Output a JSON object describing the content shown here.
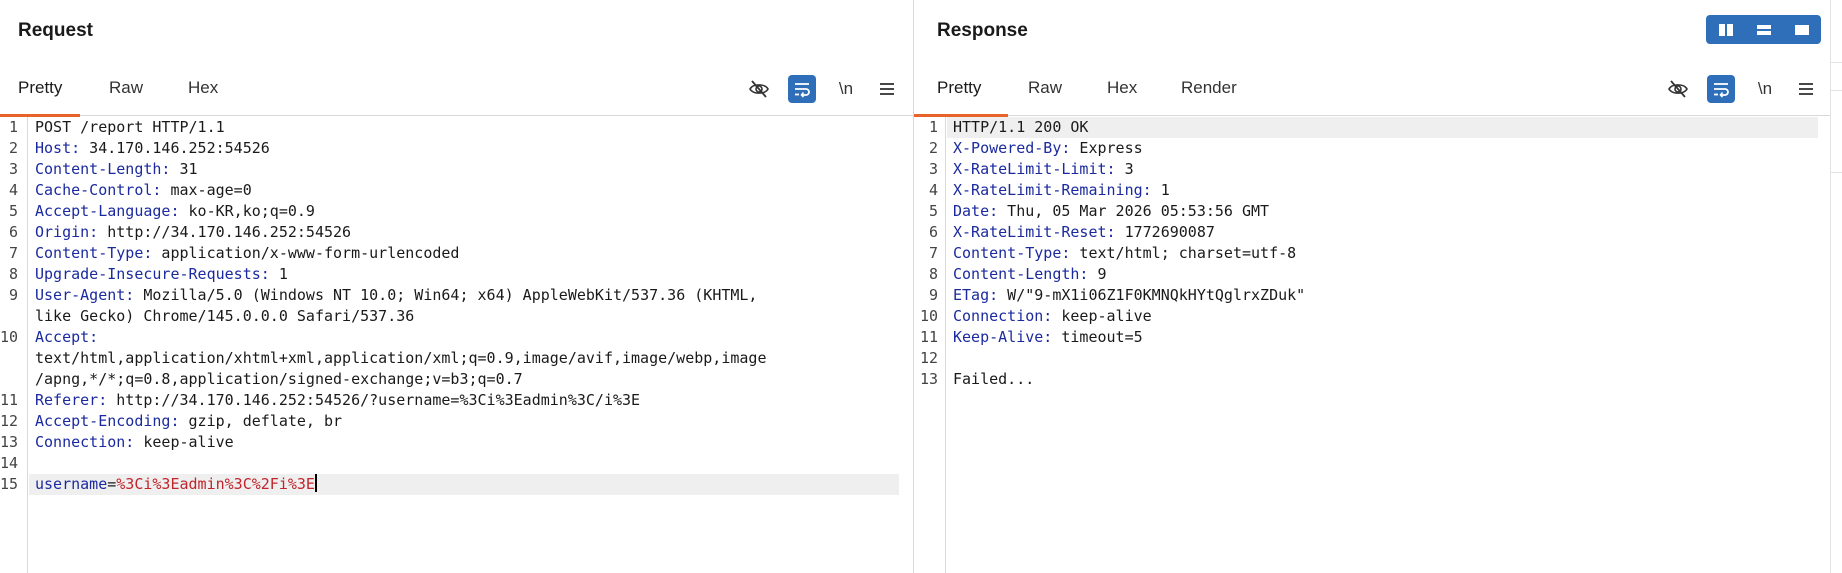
{
  "request": {
    "title": "Request",
    "tabs": [
      "Pretty",
      "Raw",
      "Hex"
    ],
    "active_tab": "Pretty",
    "newline_label": "\\n",
    "lines": [
      {
        "num": "1",
        "parts": [
          {
            "t": "POST /report HTTP/1.1",
            "c": "hv"
          }
        ]
      },
      {
        "num": "2",
        "parts": [
          {
            "t": "Host:",
            "c": "hn"
          },
          {
            "t": " 34.170.146.252:54526",
            "c": "hv"
          }
        ]
      },
      {
        "num": "3",
        "parts": [
          {
            "t": "Content-Length:",
            "c": "hn"
          },
          {
            "t": " 31",
            "c": "hv"
          }
        ]
      },
      {
        "num": "4",
        "parts": [
          {
            "t": "Cache-Control:",
            "c": "hn"
          },
          {
            "t": " max-age=0",
            "c": "hv"
          }
        ]
      },
      {
        "num": "5",
        "parts": [
          {
            "t": "Accept-Language:",
            "c": "hn"
          },
          {
            "t": " ko-KR,ko;q=0.9",
            "c": "hv"
          }
        ]
      },
      {
        "num": "6",
        "parts": [
          {
            "t": "Origin:",
            "c": "hn"
          },
          {
            "t": " http://34.170.146.252:54526",
            "c": "hv"
          }
        ]
      },
      {
        "num": "7",
        "parts": [
          {
            "t": "Content-Type:",
            "c": "hn"
          },
          {
            "t": " application/x-www-form-urlencoded",
            "c": "hv"
          }
        ]
      },
      {
        "num": "8",
        "parts": [
          {
            "t": "Upgrade-Insecure-Requests:",
            "c": "hn"
          },
          {
            "t": " 1",
            "c": "hv"
          }
        ]
      },
      {
        "num": "9",
        "parts": [
          {
            "t": "User-Agent:",
            "c": "hn"
          },
          {
            "t": " Mozilla/5.0 (Windows NT 10.0; Win64; x64) AppleWebKit/537.36 (KHTML,",
            "c": "hv"
          }
        ]
      },
      {
        "num": "",
        "parts": [
          {
            "t": "like Gecko) Chrome/145.0.0.0 Safari/537.36",
            "c": "hv"
          }
        ]
      },
      {
        "num": "10",
        "parts": [
          {
            "t": "Accept:",
            "c": "hn"
          }
        ]
      },
      {
        "num": "",
        "parts": [
          {
            "t": "text/html,application/xhtml+xml,application/xml;q=0.9,image/avif,image/webp,image",
            "c": "hv"
          }
        ]
      },
      {
        "num": "",
        "parts": [
          {
            "t": "/apng,*/*;q=0.8,application/signed-exchange;v=b3;q=0.7",
            "c": "hv"
          }
        ]
      },
      {
        "num": "11",
        "parts": [
          {
            "t": "Referer:",
            "c": "hn"
          },
          {
            "t": " http://34.170.146.252:54526/?username=%3Ci%3Eadmin%3C/i%3E",
            "c": "hv"
          }
        ]
      },
      {
        "num": "12",
        "parts": [
          {
            "t": "Accept-Encoding:",
            "c": "hn"
          },
          {
            "t": " gzip, deflate, br",
            "c": "hv"
          }
        ]
      },
      {
        "num": "13",
        "parts": [
          {
            "t": "Connection:",
            "c": "hn"
          },
          {
            "t": " keep-alive",
            "c": "hv"
          }
        ]
      },
      {
        "num": "14",
        "parts": []
      },
      {
        "num": "15",
        "highlight": true,
        "caret": true,
        "parts": [
          {
            "t": "username",
            "c": "pk"
          },
          {
            "t": "=",
            "c": "pe"
          },
          {
            "t": "%3Ci%3Eadmin%3C%2Fi%3E",
            "c": "pv"
          }
        ]
      }
    ]
  },
  "response": {
    "title": "Response",
    "tabs": [
      "Pretty",
      "Raw",
      "Hex",
      "Render"
    ],
    "active_tab": "Pretty",
    "newline_label": "\\n",
    "lines": [
      {
        "num": "1",
        "highlight": true,
        "parts": [
          {
            "t": "HTTP/1.1 200 OK",
            "c": "hv"
          }
        ]
      },
      {
        "num": "2",
        "parts": [
          {
            "t": "X-Powered-By:",
            "c": "hn"
          },
          {
            "t": " Express",
            "c": "hv"
          }
        ]
      },
      {
        "num": "3",
        "parts": [
          {
            "t": "X-RateLimit-Limit:",
            "c": "hn"
          },
          {
            "t": " 3",
            "c": "hv"
          }
        ]
      },
      {
        "num": "4",
        "parts": [
          {
            "t": "X-RateLimit-Remaining:",
            "c": "hn"
          },
          {
            "t": " 1",
            "c": "hv"
          }
        ]
      },
      {
        "num": "5",
        "parts": [
          {
            "t": "Date:",
            "c": "hn"
          },
          {
            "t": " Thu, 05 Mar 2026 05:53:56 GMT",
            "c": "hv"
          }
        ]
      },
      {
        "num": "6",
        "parts": [
          {
            "t": "X-RateLimit-Reset:",
            "c": "hn"
          },
          {
            "t": " 1772690087",
            "c": "hv"
          }
        ]
      },
      {
        "num": "7",
        "parts": [
          {
            "t": "Content-Type:",
            "c": "hn"
          },
          {
            "t": " text/html; charset=utf-8",
            "c": "hv"
          }
        ]
      },
      {
        "num": "8",
        "parts": [
          {
            "t": "Content-Length:",
            "c": "hn"
          },
          {
            "t": " 9",
            "c": "hv"
          }
        ]
      },
      {
        "num": "9",
        "parts": [
          {
            "t": "ETag:",
            "c": "hn"
          },
          {
            "t": " W/\"9-mX1i06Z1F0KMNQkHYtQglrxZDuk\"",
            "c": "hv"
          }
        ]
      },
      {
        "num": "10",
        "parts": [
          {
            "t": "Connection:",
            "c": "hn"
          },
          {
            "t": " keep-alive",
            "c": "hv"
          }
        ]
      },
      {
        "num": "11",
        "parts": [
          {
            "t": "Keep-Alive:",
            "c": "hn"
          },
          {
            "t": " timeout=5",
            "c": "hv"
          }
        ]
      },
      {
        "num": "12",
        "parts": []
      },
      {
        "num": "13",
        "parts": [
          {
            "t": "Failed...",
            "c": "hv"
          }
        ]
      }
    ]
  },
  "layout_switch": {
    "options": [
      "side-by-side",
      "stacked",
      "single"
    ],
    "active": "side-by-side"
  },
  "colors": {
    "accent": "#e8622a",
    "toggle_blue": "#2f6fba",
    "header_name": "#1b2a9e",
    "param_value": "#c0252b"
  },
  "icons": {
    "hide_icon": "eye-slash-icon",
    "wrap_icon": "word-wrap-icon",
    "menu_icon": "hamburger-menu-icon"
  }
}
